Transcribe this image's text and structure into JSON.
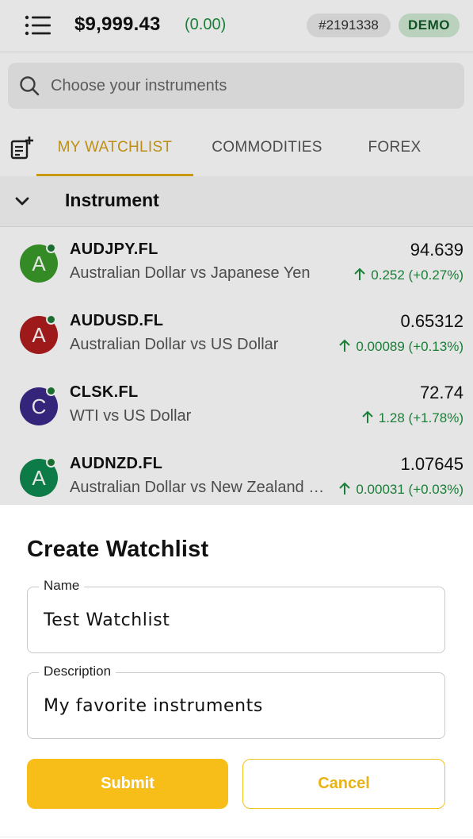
{
  "header": {
    "menu_icon": "menu-list-icon",
    "balance": "$9,999.43",
    "balance_change": "(0.00)",
    "account_number": "#2191338",
    "mode_badge": "DEMO",
    "colors": {
      "positive": "#1e8e3e",
      "demo_badge_bg": "#cfe9d3"
    }
  },
  "search": {
    "icon": "search-icon",
    "placeholder": "Choose your instruments"
  },
  "tabs": {
    "add_icon": "add-watchlist-icon",
    "items": [
      {
        "label": "MY WATCHLIST",
        "active": true
      },
      {
        "label": "COMMODITIES",
        "active": false
      },
      {
        "label": "FOREX",
        "active": false
      }
    ],
    "accent": "#e0ac12"
  },
  "list": {
    "header_title": "Instrument",
    "rows": [
      {
        "avatar_letter": "A",
        "avatar_color": "#3a9a2a",
        "symbol": "AUDJPY.FL",
        "description": "Australian Dollar vs Japanese Yen",
        "price": "94.639",
        "change": "0.252 (+0.27%)"
      },
      {
        "avatar_letter": "A",
        "avatar_color": "#b01c1c",
        "symbol": "AUDUSD.FL",
        "description": "Australian Dollar vs US Dollar",
        "price": "0.65312",
        "change": "0.00089 (+0.13%)"
      },
      {
        "avatar_letter": "C",
        "avatar_color": "#3a2a8a",
        "symbol": "CLSK.FL",
        "description": "WTI vs US Dollar",
        "price": "72.74",
        "change": "1.28 (+1.78%)"
      },
      {
        "avatar_letter": "A",
        "avatar_color": "#0f8a50",
        "symbol": "AUDNZD.FL",
        "description": "Australian Dollar vs New Zealand Dollar",
        "price": "1.07645",
        "change": "0.00031 (+0.03%)"
      }
    ]
  },
  "dialog": {
    "title": "Create Watchlist",
    "name_label": "Name",
    "name_value": "Test Watchlist",
    "description_label": "Description",
    "description_value": "My favorite instruments",
    "submit_label": "Submit",
    "cancel_label": "Cancel",
    "colors": {
      "primary": "#f7be1a"
    }
  }
}
